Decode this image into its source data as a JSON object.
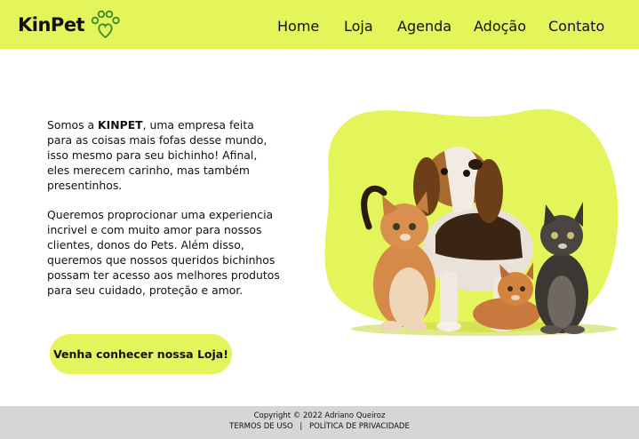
{
  "brand": {
    "name": "KinPet",
    "logo_icon": "paw-heart-icon",
    "accent_color": "#e3f55a"
  },
  "nav": {
    "items": [
      "Home",
      "Loja",
      "Agenda",
      "Adoção",
      "Contato"
    ]
  },
  "intro": {
    "p1_before": "Somos a ",
    "p1_brand": "KINPET",
    "p1_after": ", uma empresa feita para as coisas mais fofas desse mundo, isso mesmo para seu bichinho! Afinal, eles merecem carinho, mas também presentinhos.",
    "p2": "Queremos proprocionar uma experiencia incrivel e com muito amor para nossos clientes, donos do Pets. Além disso, queremos que nossos queridos bichinhos possam ter acesso aos melhores produtos para seu cuidado, proteção e amor."
  },
  "cta": {
    "label": "Venha conhecer nossa Loja!"
  },
  "footer": {
    "copyright": "Copyright © 2022 Adriano Queiroz",
    "terms": "TERMOS DE USO",
    "separator": "|",
    "privacy": "POLÍTICA DE PRIVACIDADE",
    "background": "#d6d6d6"
  }
}
